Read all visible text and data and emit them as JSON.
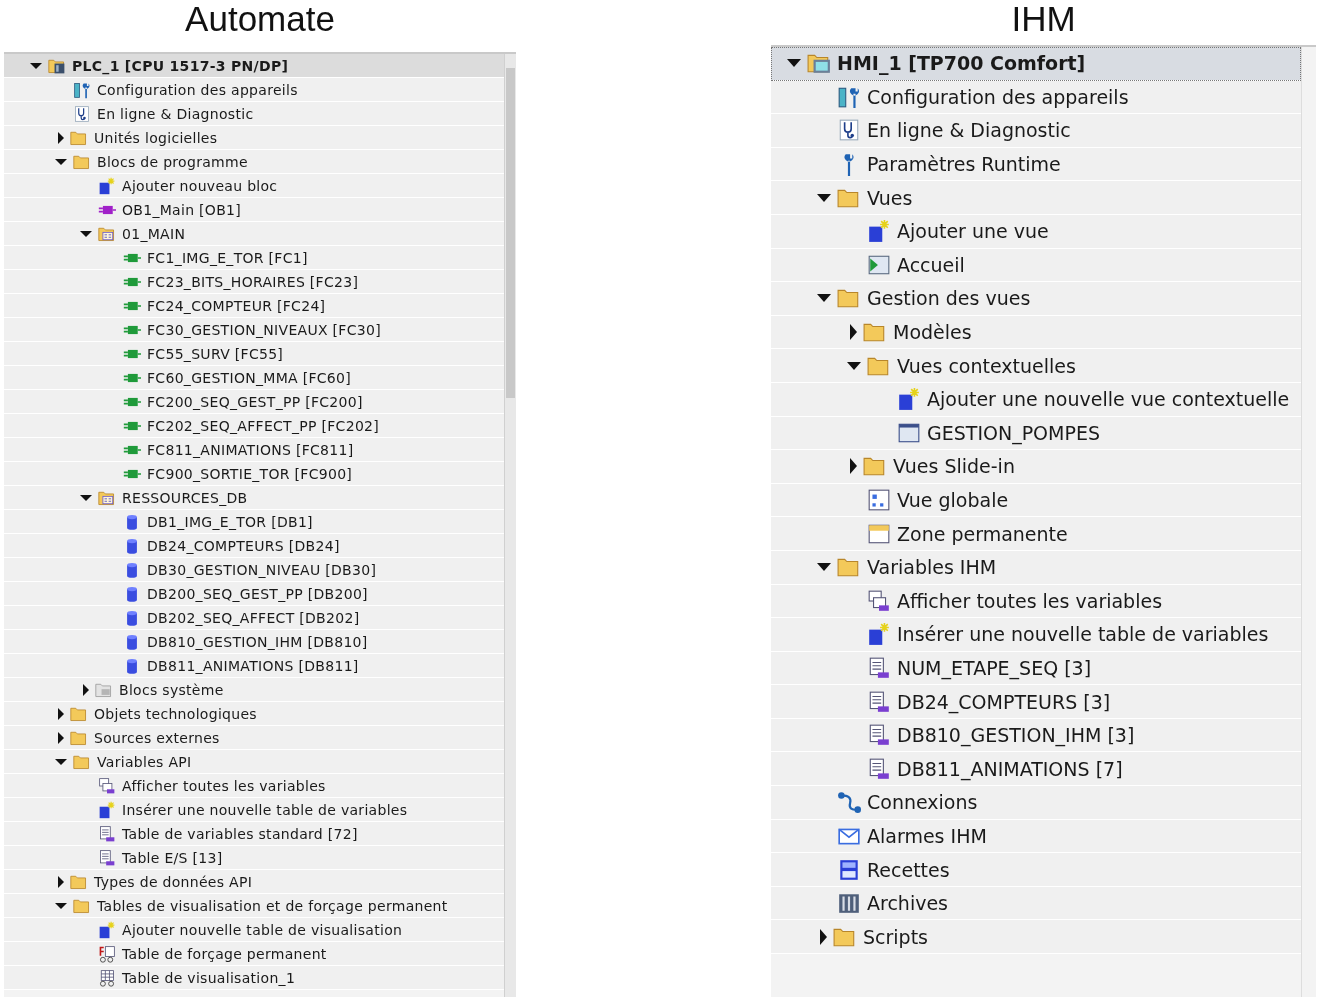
{
  "panels": [
    {
      "title": "Automate",
      "tree": [
        {
          "label": "PLC_1 [CPU 1517-3 PN/DP]",
          "kind": "plc",
          "selected": true,
          "expanded": true,
          "children": [
            {
              "label": "Configuration des appareils",
              "kind": "config",
              "selected": false
            },
            {
              "label": "En ligne & Diagnostic",
              "kind": "diag",
              "selected": false
            },
            {
              "label": "Unités logicielles",
              "kind": "folder",
              "selected": false,
              "expanded": false
            },
            {
              "label": "Blocs de programme",
              "kind": "folder",
              "selected": false,
              "expanded": true,
              "children": [
                {
                  "label": "Ajouter nouveau bloc",
                  "kind": "add",
                  "selected": false
                },
                {
                  "label": "OB1_Main [OB1]",
                  "kind": "ob",
                  "selected": false
                },
                {
                  "label": "01_MAIN",
                  "kind": "group",
                  "selected": false,
                  "expanded": true,
                  "children": [
                    {
                      "label": "FC1_IMG_E_TOR [FC1]",
                      "kind": "fc",
                      "selected": false
                    },
                    {
                      "label": "FC23_BITS_HORAIRES [FC23]",
                      "kind": "fc",
                      "selected": false
                    },
                    {
                      "label": "FC24_COMPTEUR [FC24]",
                      "kind": "fc",
                      "selected": false
                    },
                    {
                      "label": "FC30_GESTION_NIVEAUX [FC30]",
                      "kind": "fc",
                      "selected": false
                    },
                    {
                      "label": "FC55_SURV [FC55]",
                      "kind": "fc",
                      "selected": false
                    },
                    {
                      "label": "FC60_GESTION_MMA [FC60]",
                      "kind": "fc",
                      "selected": false
                    },
                    {
                      "label": "FC200_SEQ_GEST_PP [FC200]",
                      "kind": "fc",
                      "selected": false
                    },
                    {
                      "label": "FC202_SEQ_AFFECT_PP [FC202]",
                      "kind": "fc",
                      "selected": false
                    },
                    {
                      "label": "FC811_ANIMATIONS [FC811]",
                      "kind": "fc",
                      "selected": false
                    },
                    {
                      "label": "FC900_SORTIE_TOR [FC900]",
                      "kind": "fc",
                      "selected": false
                    }
                  ]
                },
                {
                  "label": "RESSOURCES_DB",
                  "kind": "group",
                  "selected": false,
                  "expanded": true,
                  "children": [
                    {
                      "label": "DB1_IMG_E_TOR [DB1]",
                      "kind": "db",
                      "selected": false
                    },
                    {
                      "label": "DB24_COMPTEURS [DB24]",
                      "kind": "db",
                      "selected": false
                    },
                    {
                      "label": "DB30_GESTION_NIVEAU [DB30]",
                      "kind": "db",
                      "selected": false
                    },
                    {
                      "label": "DB200_SEQ_GEST_PP [DB200]",
                      "kind": "db",
                      "selected": false
                    },
                    {
                      "label": "DB202_SEQ_AFFECT [DB202]",
                      "kind": "db",
                      "selected": false
                    },
                    {
                      "label": "DB810_GESTION_IHM [DB810]",
                      "kind": "db",
                      "selected": false
                    },
                    {
                      "label": "DB811_ANIMATIONS [DB811]",
                      "kind": "db",
                      "selected": false
                    }
                  ]
                },
                {
                  "label": "Blocs système",
                  "kind": "sysfolder",
                  "selected": false,
                  "expanded": false
                }
              ]
            },
            {
              "label": "Objets technologiques",
              "kind": "folder",
              "selected": false,
              "expanded": false
            },
            {
              "label": "Sources externes",
              "kind": "folder",
              "selected": false,
              "expanded": false
            },
            {
              "label": "Variables API",
              "kind": "folder",
              "selected": false,
              "expanded": true,
              "children": [
                {
                  "label": "Afficher toutes les variables",
                  "kind": "vars",
                  "selected": false
                },
                {
                  "label": "Insérer une nouvelle table de variables",
                  "kind": "add",
                  "selected": false
                },
                {
                  "label": "Table de variables standard [72]",
                  "kind": "vartable",
                  "selected": false
                },
                {
                  "label": "Table E/S [13]",
                  "kind": "vartable",
                  "selected": false
                }
              ]
            },
            {
              "label": "Types de données API",
              "kind": "folder",
              "selected": false,
              "expanded": false
            },
            {
              "label": "Tables de visualisation et de forçage permanent",
              "kind": "folder",
              "selected": false,
              "expanded": true,
              "children": [
                {
                  "label": "Ajouter nouvelle table de visualisation",
                  "kind": "add",
                  "selected": false
                },
                {
                  "label": "Table de forçage permanent",
                  "kind": "forcetable",
                  "selected": false
                },
                {
                  "label": "Table de visualisation_1",
                  "kind": "watchtable",
                  "selected": false
                }
              ]
            }
          ]
        }
      ]
    },
    {
      "title": "IHM",
      "tree": [
        {
          "label": "HMI_1 [TP700 Comfort]",
          "kind": "hmi",
          "selected": true,
          "expanded": true,
          "children": [
            {
              "label": "Configuration des appareils",
              "kind": "config",
              "selected": false
            },
            {
              "label": "En ligne & Diagnostic",
              "kind": "diag",
              "selected": false
            },
            {
              "label": "Paramètres Runtime",
              "kind": "wrench",
              "selected": false
            },
            {
              "label": "Vues",
              "kind": "folder",
              "selected": false,
              "expanded": true,
              "children": [
                {
                  "label": "Ajouter une vue",
                  "kind": "add",
                  "selected": false
                },
                {
                  "label": "Accueil",
                  "kind": "startscreen",
                  "selected": false
                }
              ]
            },
            {
              "label": "Gestion des vues",
              "kind": "folder",
              "selected": false,
              "expanded": true,
              "children": [
                {
                  "label": "Modèles",
                  "kind": "folder",
                  "selected": false,
                  "expanded": false
                },
                {
                  "label": "Vues contextuelles",
                  "kind": "folder",
                  "selected": false,
                  "expanded": true,
                  "children": [
                    {
                      "label": "Ajouter une nouvelle vue contextuelle",
                      "kind": "add",
                      "selected": false
                    },
                    {
                      "label": "GESTION_POMPES",
                      "kind": "screen",
                      "selected": false
                    }
                  ]
                },
                {
                  "label": "Vues Slide-in",
                  "kind": "folder",
                  "selected": false,
                  "expanded": false
                },
                {
                  "label": "Vue globale",
                  "kind": "overview",
                  "selected": false
                },
                {
                  "label": "Zone permanente",
                  "kind": "permzone",
                  "selected": false
                }
              ]
            },
            {
              "label": "Variables IHM",
              "kind": "folder",
              "selected": false,
              "expanded": true,
              "children": [
                {
                  "label": "Afficher toutes les variables",
                  "kind": "vars",
                  "selected": false
                },
                {
                  "label": "Insérer une nouvelle table de variables",
                  "kind": "add",
                  "selected": false
                },
                {
                  "label": "NUM_ETAPE_SEQ [3]",
                  "kind": "vartable",
                  "selected": false
                },
                {
                  "label": "DB24_COMPTEURS [3]",
                  "kind": "vartable",
                  "selected": false
                },
                {
                  "label": "DB810_GESTION_IHM [3]",
                  "kind": "vartable",
                  "selected": false
                },
                {
                  "label": "DB811_ANIMATIONS [7]",
                  "kind": "vartable",
                  "selected": false
                }
              ]
            },
            {
              "label": "Connexions",
              "kind": "connections",
              "selected": false
            },
            {
              "label": "Alarmes IHM",
              "kind": "alarm",
              "selected": false
            },
            {
              "label": "Recettes",
              "kind": "recipe",
              "selected": false
            },
            {
              "label": "Archives",
              "kind": "archive",
              "selected": false
            },
            {
              "label": "Scripts",
              "kind": "folder",
              "selected": false,
              "expanded": false
            }
          ]
        }
      ]
    }
  ]
}
